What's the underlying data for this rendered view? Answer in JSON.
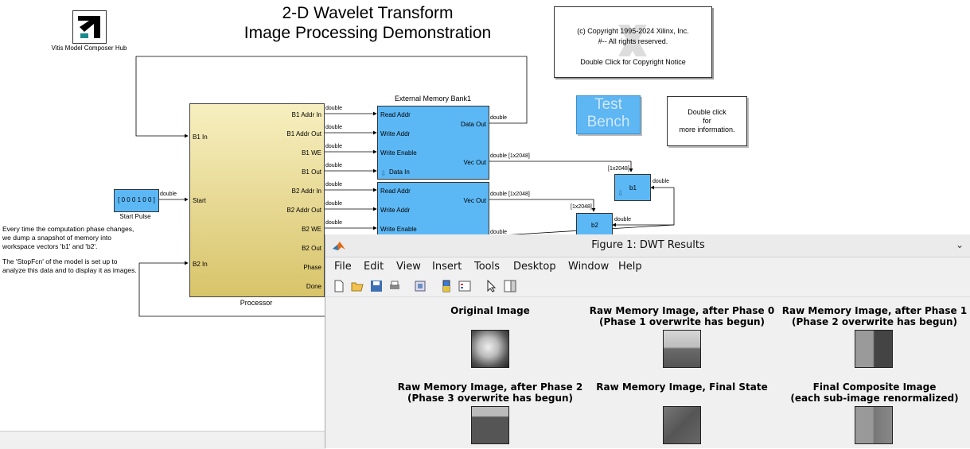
{
  "model": {
    "title_line1": "2-D Wavelet Transform",
    "title_line2": "Image Processing Demonstration",
    "hub_label": "Vitis Model Composer Hub",
    "copyright_line1": "(c) Copyright 1995-2024 Xilinx, Inc.",
    "copyright_line2": "#-- All rights reserved.",
    "copyright_line3": "Double Click for Copyright Notice",
    "testbench_line1": "Test",
    "testbench_line2": "Bench",
    "info_line1": "Double click",
    "info_line2": "for",
    "info_line3": "more information.",
    "processor_label": "Processor",
    "processor_in_ports": [
      "B1 In",
      "Start",
      "B2 In"
    ],
    "processor_out_ports": [
      "B1 Addr In",
      "B1 Addr Out",
      "B1 WE",
      "B1 Out",
      "B2 Addr In",
      "B2 Addr Out",
      "B2 WE",
      "B2 Out",
      "Phase",
      "Done"
    ],
    "memory_label": "External Memory Bank1",
    "memory1_ports": [
      "Read Addr",
      "Write Addr",
      "Write Enable",
      "Data In"
    ],
    "memory1_out": [
      "Data Out",
      "Vec Out"
    ],
    "memory2_ports": [
      "Read Addr",
      "Write Addr",
      "Write Enable"
    ],
    "memory2_out": [
      "Vec Out"
    ],
    "signal_double": "double",
    "signal_vec": "double [1x2048]",
    "signal_dim": "[1x2048]",
    "sink_b1": "b1",
    "sink_b2": "b2",
    "start_pulse_value": "[ 0 0 0 1 0 0 ]",
    "start_pulse_label": "Start Pulse",
    "note_para1": "Every time the computation phase changes, we dump a snapshot of memory into workspace vectors  'b1' and  'b2'.",
    "note_para2": "The 'StopFcn' of the model is set up to analyze this data and to display it as images."
  },
  "figure": {
    "title": "Figure 1: DWT Results",
    "menu": [
      "File",
      "Edit",
      "View",
      "Insert",
      "Tools",
      "Desktop",
      "Window",
      "Help"
    ],
    "axes": [
      {
        "title1": "Original Image",
        "title2": ""
      },
      {
        "title1": "Raw Memory Image, after Phase 0",
        "title2": "(Phase 1 overwrite has begun)"
      },
      {
        "title1": "Raw Memory Image, after Phase 1",
        "title2": "(Phase 2 overwrite has begun)"
      },
      {
        "title1": "Raw Memory Image, after Phase 2",
        "title2": "(Phase 3 overwrite has begun)"
      },
      {
        "title1": "Raw Memory Image, Final State",
        "title2": ""
      },
      {
        "title1": "Final Composite Image",
        "title2": "(each sub-image renormalized)"
      }
    ],
    "colors": {
      "memory_block": "#5cb8f5",
      "processor_block": "#e8d98a"
    }
  }
}
